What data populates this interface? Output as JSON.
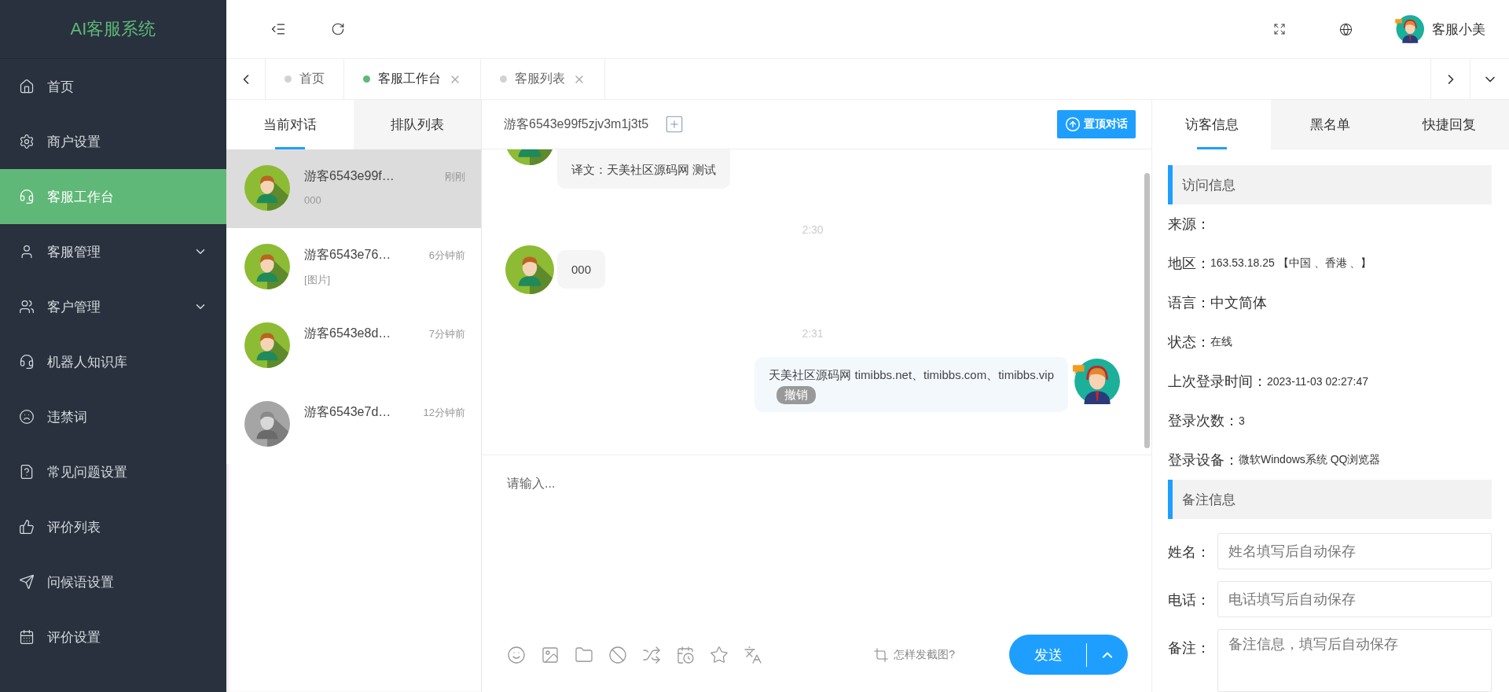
{
  "sidebar": {
    "logo": "AI客服系统",
    "items": [
      {
        "label": "首页",
        "kind": "link",
        "selected": false
      },
      {
        "label": "商户设置",
        "kind": "link",
        "selected": false
      },
      {
        "label": "客服工作台",
        "kind": "link",
        "selected": true
      },
      {
        "label": "客服管理",
        "kind": "group",
        "selected": false
      },
      {
        "label": "客户管理",
        "kind": "group",
        "selected": false
      },
      {
        "label": "机器人知识库",
        "kind": "link",
        "selected": false
      },
      {
        "label": "违禁词",
        "kind": "link",
        "selected": false
      },
      {
        "label": "常见问题设置",
        "kind": "link",
        "selected": false
      },
      {
        "label": "评价列表",
        "kind": "link",
        "selected": false
      },
      {
        "label": "问候语设置",
        "kind": "link",
        "selected": false
      },
      {
        "label": "评价设置",
        "kind": "link",
        "selected": false
      }
    ]
  },
  "header": {
    "user": "客服小美"
  },
  "page_tabs": [
    {
      "label": "首页",
      "selected": false,
      "closable": false
    },
    {
      "label": "客服工作台",
      "selected": true,
      "closable": true
    },
    {
      "label": "客服列表",
      "selected": false,
      "closable": true
    }
  ],
  "conversation_tabs": [
    {
      "label": "当前对话",
      "selected": true
    },
    {
      "label": "排队列表",
      "selected": false
    }
  ],
  "conversations": [
    {
      "name": "游客6543e99f…",
      "time": "刚刚",
      "preview": "000",
      "selected": true,
      "online": true
    },
    {
      "name": "游客6543e76…",
      "time": "6分钟前",
      "preview": "[图片]",
      "selected": false,
      "online": true
    },
    {
      "name": "游客6543e8d…",
      "time": "7分钟前",
      "selected": false,
      "online": true
    },
    {
      "name": "游客6543e7d…",
      "time": "12分钟前",
      "selected": false,
      "online": false
    }
  ],
  "chat": {
    "title": "游客6543e99f5zjv3m1j3t5",
    "pin_button": "置顶对话",
    "messages": [
      {
        "kind": "translation",
        "text": "译文：天美社区源码网 测试"
      },
      {
        "kind": "time",
        "text": "2:30"
      },
      {
        "kind": "visitor",
        "text": "000"
      },
      {
        "kind": "time",
        "text": "2:31"
      },
      {
        "kind": "agent",
        "text": "天美社区源码网 timibbs.net、timibbs.com、timibbs.vip",
        "recall": "撤销"
      }
    ],
    "input_placeholder": "请输入...",
    "screenshot_help": "怎样发截图?",
    "send": "发送"
  },
  "visitor_panel": {
    "tabs": [
      {
        "label": "访客信息",
        "selected": true
      },
      {
        "label": "黑名单",
        "selected": false
      },
      {
        "label": "快捷回复",
        "selected": false
      }
    ],
    "visit_section": "访问信息",
    "rows": [
      {
        "label": "来源："
      },
      {
        "label": "地区：",
        "value": "163.53.18.25 【中国 、香港 、】"
      },
      {
        "label": "语言：",
        "value": "中文简体",
        "kind": "large"
      },
      {
        "label": "状态：",
        "value": "在线"
      },
      {
        "label": "上次登录时间：",
        "value": "2023-11-03 02:27:47"
      },
      {
        "label": "登录次数：",
        "value": "3"
      },
      {
        "label": "登录设备：",
        "value": "微软Windows系统 QQ浏览器"
      }
    ],
    "notes_section": "备注信息",
    "fields": [
      {
        "label": "姓名：",
        "placeholder": "姓名填写后自动保存",
        "kind": "input"
      },
      {
        "label": "电话：",
        "placeholder": "电话填写后自动保存",
        "kind": "input"
      },
      {
        "label": "备注：",
        "placeholder": "备注信息，填写后自动保存",
        "kind": "textarea"
      }
    ]
  }
}
